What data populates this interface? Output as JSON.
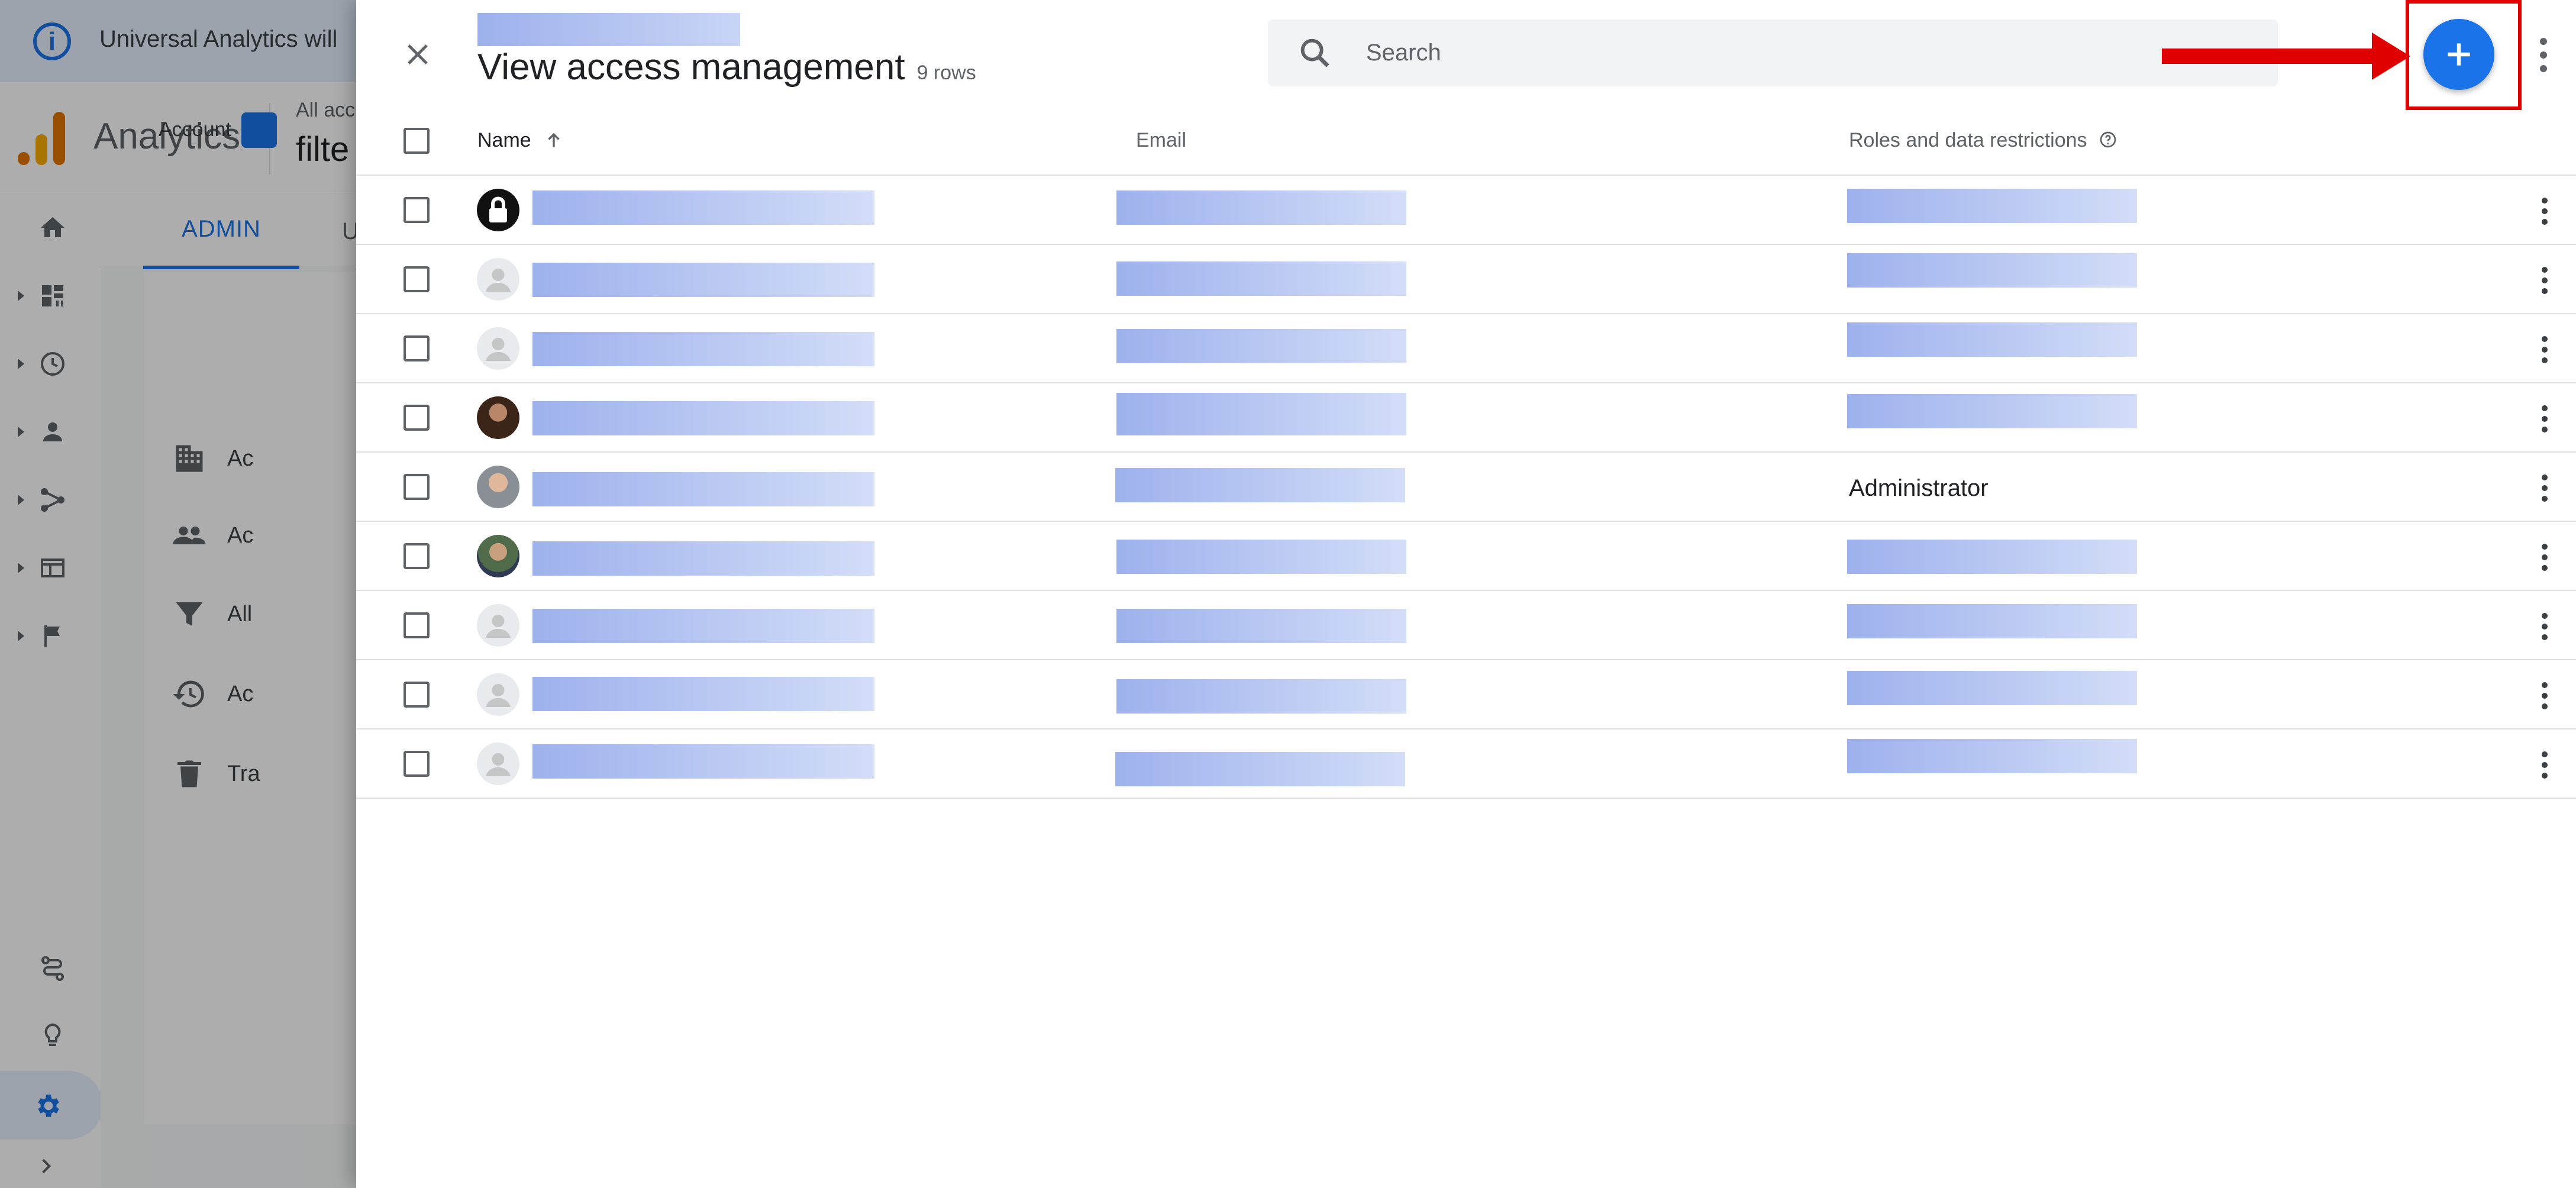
{
  "banner": {
    "text": "Universal Analytics will"
  },
  "header": {
    "app_title": "Analytics",
    "account_small": "All acc",
    "account_name": "filte"
  },
  "admin": {
    "tab_admin": "ADMIN",
    "tab_user": "U",
    "account_label": "Account",
    "items": [
      {
        "label": "Ac",
        "icon": "building-icon"
      },
      {
        "label": "Ac",
        "icon": "people-icon"
      },
      {
        "label": "All",
        "icon": "filter-icon"
      },
      {
        "label": "Ac",
        "icon": "history-icon"
      },
      {
        "label": "Tra",
        "icon": "trash-icon"
      }
    ]
  },
  "dialog": {
    "title": "View access management",
    "row_count": "9 rows",
    "search_placeholder": "Search",
    "columns": {
      "name": "Name",
      "email": "Email",
      "roles": "Roles and data restrictions"
    },
    "rows": [
      {
        "avatar": "lock",
        "role": ""
      },
      {
        "avatar": "default",
        "role": ""
      },
      {
        "avatar": "default",
        "role": ""
      },
      {
        "avatar": "photo",
        "role": ""
      },
      {
        "avatar": "photo",
        "role": "Administrator"
      },
      {
        "avatar": "photo",
        "role": ""
      },
      {
        "avatar": "default",
        "role": ""
      },
      {
        "avatar": "default",
        "role": ""
      },
      {
        "avatar": "default",
        "role": ""
      }
    ]
  },
  "colors": {
    "accent": "#1a73e8",
    "annotation": "#e00000",
    "redaction": "#9db1ec"
  }
}
